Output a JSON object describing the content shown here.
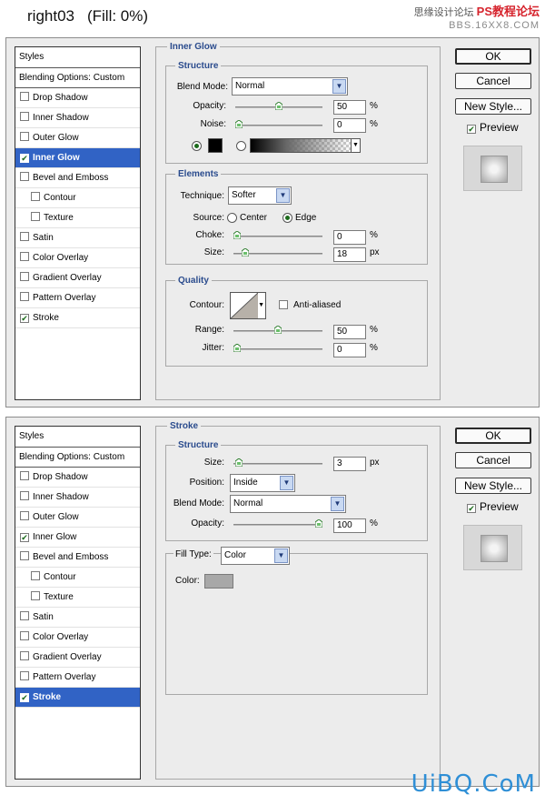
{
  "page": {
    "title": "right03",
    "fill": "(Fill: 0%)"
  },
  "watermark": {
    "line1": "思缘设计论坛",
    "line2": "BBS.16XX8.COM",
    "mark": "PS教程论坛"
  },
  "footer": {
    "logo": "UiBQ.CoM"
  },
  "buttons": {
    "ok": "OK",
    "cancel": "Cancel",
    "new_style": "New Style...",
    "preview": "Preview"
  },
  "styles_list": {
    "header": "Styles",
    "blending": "Blending Options: Custom",
    "items": [
      {
        "label": "Drop Shadow",
        "sub": false
      },
      {
        "label": "Inner Shadow",
        "sub": false
      },
      {
        "label": "Outer Glow",
        "sub": false
      },
      {
        "label": "Inner Glow",
        "sub": false
      },
      {
        "label": "Bevel and Emboss",
        "sub": false
      },
      {
        "label": "Contour",
        "sub": true
      },
      {
        "label": "Texture",
        "sub": true
      },
      {
        "label": "Satin",
        "sub": false
      },
      {
        "label": "Color Overlay",
        "sub": false
      },
      {
        "label": "Gradient Overlay",
        "sub": false
      },
      {
        "label": "Pattern Overlay",
        "sub": false
      },
      {
        "label": "Stroke",
        "sub": false
      }
    ]
  },
  "dialog1": {
    "checked": [
      false,
      false,
      false,
      true,
      false,
      false,
      false,
      false,
      false,
      false,
      false,
      true
    ],
    "selected_index": 3,
    "inner_glow": {
      "title": "Inner Glow",
      "structure": {
        "title": "Structure",
        "blend_mode_label": "Blend Mode:",
        "blend_mode": "Normal",
        "opacity_label": "Opacity:",
        "opacity": "50",
        "opacity_fraction": 0.5,
        "noise_label": "Noise:",
        "noise": "0",
        "noise_fraction": 0.0,
        "pct": "%"
      },
      "elements": {
        "title": "Elements",
        "technique_label": "Technique:",
        "technique": "Softer",
        "source_label": "Source:",
        "source_center": "Center",
        "source_edge": "Edge",
        "choke_label": "Choke:",
        "choke": "0",
        "choke_fraction": 0.0,
        "size_label": "Size:",
        "size": "18",
        "size_fraction": 0.1,
        "pct": "%",
        "px": "px"
      },
      "quality": {
        "title": "Quality",
        "contour_label": "Contour:",
        "anti_aliased": "Anti-aliased",
        "range_label": "Range:",
        "range": "50",
        "range_fraction": 0.5,
        "jitter_label": "Jitter:",
        "jitter": "0",
        "jitter_fraction": 0.0,
        "pct": "%"
      }
    }
  },
  "dialog2": {
    "checked": [
      false,
      false,
      false,
      true,
      false,
      false,
      false,
      false,
      false,
      false,
      false,
      true
    ],
    "selected_index": 11,
    "stroke": {
      "title": "Stroke",
      "structure": {
        "title": "Structure",
        "size_label": "Size:",
        "size": "3",
        "size_fraction": 0.02,
        "px": "px",
        "position_label": "Position:",
        "position": "Inside",
        "blend_mode_label": "Blend Mode:",
        "blend_mode": "Normal",
        "opacity_label": "Opacity:",
        "opacity": "100",
        "opacity_fraction": 1.0,
        "pct": "%"
      },
      "fill": {
        "fill_type_label": "Fill Type:",
        "fill_type": "Color",
        "color_label": "Color:",
        "color": "#a8a8a8"
      }
    }
  },
  "colors": {
    "selection": "#3163c5",
    "section_title": "#2a4b8d",
    "glow_color": "#000000"
  }
}
